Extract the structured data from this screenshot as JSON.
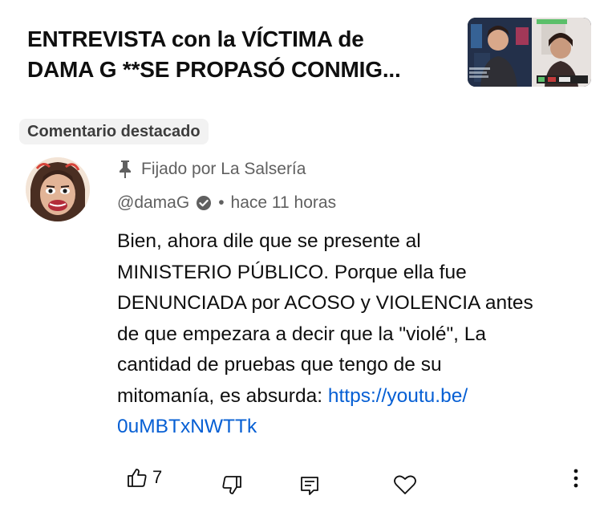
{
  "video": {
    "title_line1": "ENTREVISTA con la VÍCTIMA de",
    "title_line2": "DAMA G **SE PROPASÓ CONMIG..."
  },
  "badge": {
    "label": "Comentario destacado"
  },
  "comment": {
    "pinned_label": "Fijado por La Salsería",
    "author": "@damaG",
    "separator": "•",
    "timestamp": "hace 11 horas",
    "lines": [
      "Bien, ahora dile que se presente al",
      "MINISTERIO PÚBLICO. Porque ella fue",
      "DENUNCIADA por ACOSO y VIOLENCIA antes",
      "de que empezara a decir que la \"violé\", La",
      "cantidad de pruebas que tengo de su"
    ],
    "last_line_prefix": "mitomanía, es absurda: ",
    "link_part1": "https://youtu.be/",
    "link_part2": "0uMBTxNWTTk",
    "likes": "7"
  },
  "icons": {
    "pin": "pin-icon",
    "verified": "verified-check-icon",
    "like": "thumbs-up-icon",
    "dislike": "thumbs-down-icon",
    "reply": "reply-icon",
    "heart": "heart-icon",
    "more": "more-vertical-icon"
  },
  "colors": {
    "text": "#0f0f0f",
    "secondary": "#606060",
    "link": "#065fd4",
    "badge_bg": "#f2f2f2"
  }
}
